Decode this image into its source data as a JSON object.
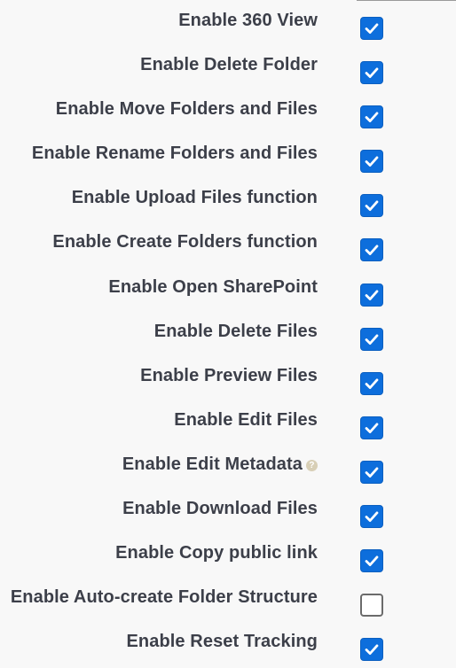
{
  "settings": [
    {
      "id": "enable-360-view",
      "label": "Enable 360 View",
      "checked": true,
      "help": false
    },
    {
      "id": "enable-delete-folder",
      "label": "Enable Delete Folder",
      "checked": true,
      "help": false
    },
    {
      "id": "enable-move-folders-and-files",
      "label": "Enable Move Folders and Files",
      "checked": true,
      "help": false
    },
    {
      "id": "enable-rename-folders-and-files",
      "label": "Enable Rename Folders and Files",
      "checked": true,
      "help": false
    },
    {
      "id": "enable-upload-files-function",
      "label": "Enable Upload Files function",
      "checked": true,
      "help": false
    },
    {
      "id": "enable-create-folders-function",
      "label": "Enable Create Folders function",
      "checked": true,
      "help": false
    },
    {
      "id": "enable-open-sharepoint",
      "label": "Enable Open SharePoint",
      "checked": true,
      "help": false
    },
    {
      "id": "enable-delete-files",
      "label": "Enable Delete Files",
      "checked": true,
      "help": false
    },
    {
      "id": "enable-preview-files",
      "label": "Enable Preview Files",
      "checked": true,
      "help": false
    },
    {
      "id": "enable-edit-files",
      "label": "Enable Edit Files",
      "checked": true,
      "help": false
    },
    {
      "id": "enable-edit-metadata",
      "label": "Enable Edit Metadata",
      "checked": true,
      "help": true
    },
    {
      "id": "enable-download-files",
      "label": "Enable Download Files",
      "checked": true,
      "help": false
    },
    {
      "id": "enable-copy-public-link",
      "label": "Enable Copy public link",
      "checked": true,
      "help": false
    },
    {
      "id": "enable-auto-create-folder-structure",
      "label": "Enable Auto-create Folder Structure",
      "checked": false,
      "help": false
    },
    {
      "id": "enable-reset-tracking",
      "label": "Enable Reset Tracking",
      "checked": true,
      "help": false
    }
  ],
  "help_icon": {
    "name": "help-icon",
    "glyph": "?"
  },
  "colors": {
    "checkbox_checked": "#0d6edc",
    "label_text": "#3c3f49",
    "help_icon": "#d8cfb6"
  }
}
